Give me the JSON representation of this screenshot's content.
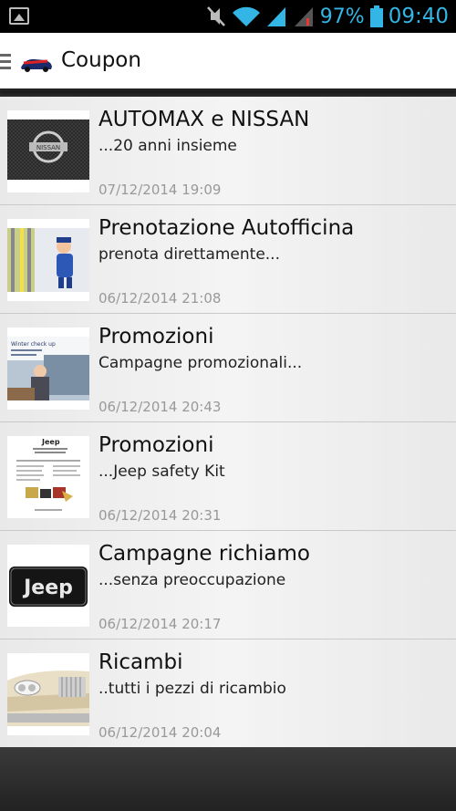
{
  "status_bar": {
    "battery_percent": "97%",
    "time": "09:40",
    "icons": [
      "gallery-icon",
      "mute-icon",
      "wifi-icon",
      "signal-icon",
      "signal-2-icon",
      "battery-icon"
    ]
  },
  "action_bar": {
    "title": "Coupon",
    "icons": [
      "menu-icon",
      "app-logo-icon"
    ]
  },
  "coupons": [
    {
      "title": "AUTOMAX e NISSAN",
      "subtitle": "...20 anni insieme",
      "date": "07/12/2014 19:09",
      "thumb": "nissan-logo-thumbnail"
    },
    {
      "title": "Prenotazione Autofficina",
      "subtitle": "prenota direttamente...",
      "date": "06/12/2014 21:08",
      "thumb": "mechanic-thumbnail"
    },
    {
      "title": "Promozioni",
      "subtitle": "Campagne promozionali...",
      "date": "06/12/2014 20:43",
      "thumb": "winter-check-thumbnail"
    },
    {
      "title": "Promozioni",
      "subtitle": "...Jeep safety Kit",
      "date": "06/12/2014 20:31",
      "thumb": "jeep-flyer-thumbnail"
    },
    {
      "title": "Campagne richiamo",
      "subtitle": "...senza preoccupazione",
      "date": "06/12/2014 20:17",
      "thumb": "jeep-plate-thumbnail"
    },
    {
      "title": "Ricambi",
      "subtitle": "..tutti i pezzi di ricambio",
      "date": "06/12/2014 20:04",
      "thumb": "car-front-thumbnail"
    }
  ],
  "thumbnail_text": {
    "nissan": "NISSAN",
    "winter_check": "Winter check up",
    "jeep_brand": "Jeep",
    "jeep_plate": "Jeep"
  },
  "colors": {
    "status_accent": "#33b5e5",
    "list_background": "#eeeeee",
    "date_text": "#999999"
  }
}
